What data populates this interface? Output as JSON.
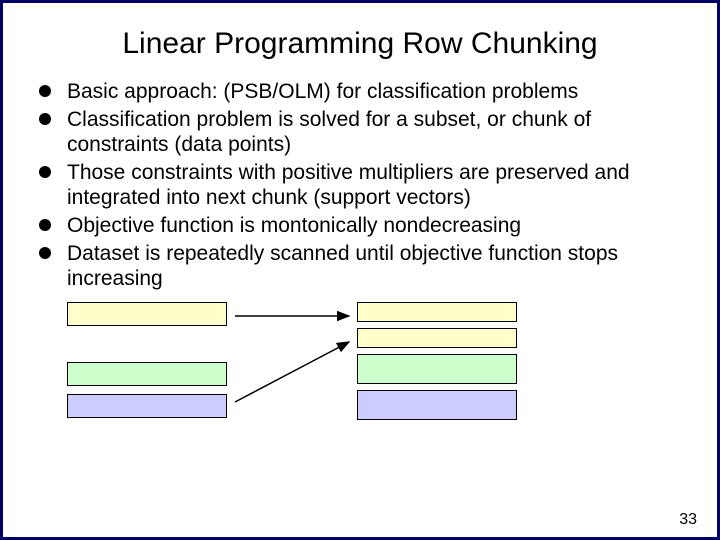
{
  "title": "Linear Programming Row Chunking",
  "bullets": [
    "Basic approach: (PSB/OLM) for classification problems",
    "Classification problem is solved for a subset, or chunk of constraints (data points)",
    "Those constraints with positive multipliers are preserved and integrated into next chunk (support vectors)",
    "Objective function is montonically nondecreasing",
    "Dataset is repeatedly scanned until objective function stops increasing"
  ],
  "page_number": "33"
}
